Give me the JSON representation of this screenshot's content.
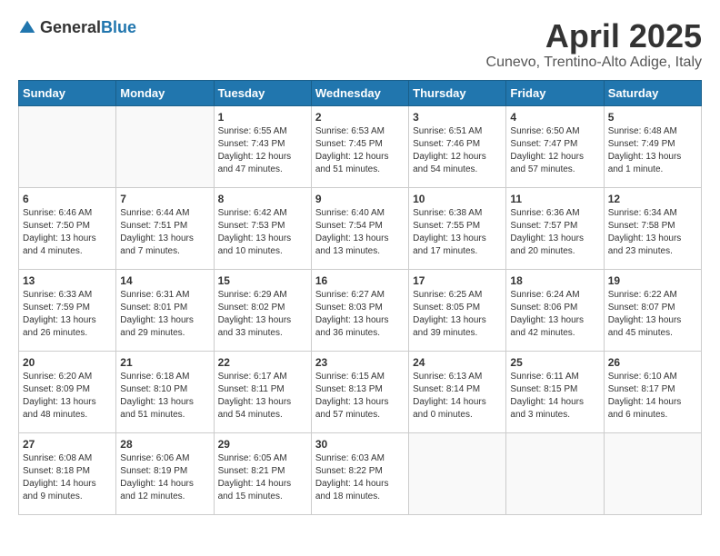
{
  "header": {
    "logo": {
      "general": "General",
      "blue": "Blue"
    },
    "title": "April 2025",
    "location": "Cunevo, Trentino-Alto Adige, Italy"
  },
  "calendar": {
    "weekdays": [
      "Sunday",
      "Monday",
      "Tuesday",
      "Wednesday",
      "Thursday",
      "Friday",
      "Saturday"
    ],
    "weeks": [
      [
        {
          "day": "",
          "info": ""
        },
        {
          "day": "",
          "info": ""
        },
        {
          "day": "1",
          "info": "Sunrise: 6:55 AM\nSunset: 7:43 PM\nDaylight: 12 hours\nand 47 minutes."
        },
        {
          "day": "2",
          "info": "Sunrise: 6:53 AM\nSunset: 7:45 PM\nDaylight: 12 hours\nand 51 minutes."
        },
        {
          "day": "3",
          "info": "Sunrise: 6:51 AM\nSunset: 7:46 PM\nDaylight: 12 hours\nand 54 minutes."
        },
        {
          "day": "4",
          "info": "Sunrise: 6:50 AM\nSunset: 7:47 PM\nDaylight: 12 hours\nand 57 minutes."
        },
        {
          "day": "5",
          "info": "Sunrise: 6:48 AM\nSunset: 7:49 PM\nDaylight: 13 hours\nand 1 minute."
        }
      ],
      [
        {
          "day": "6",
          "info": "Sunrise: 6:46 AM\nSunset: 7:50 PM\nDaylight: 13 hours\nand 4 minutes."
        },
        {
          "day": "7",
          "info": "Sunrise: 6:44 AM\nSunset: 7:51 PM\nDaylight: 13 hours\nand 7 minutes."
        },
        {
          "day": "8",
          "info": "Sunrise: 6:42 AM\nSunset: 7:53 PM\nDaylight: 13 hours\nand 10 minutes."
        },
        {
          "day": "9",
          "info": "Sunrise: 6:40 AM\nSunset: 7:54 PM\nDaylight: 13 hours\nand 13 minutes."
        },
        {
          "day": "10",
          "info": "Sunrise: 6:38 AM\nSunset: 7:55 PM\nDaylight: 13 hours\nand 17 minutes."
        },
        {
          "day": "11",
          "info": "Sunrise: 6:36 AM\nSunset: 7:57 PM\nDaylight: 13 hours\nand 20 minutes."
        },
        {
          "day": "12",
          "info": "Sunrise: 6:34 AM\nSunset: 7:58 PM\nDaylight: 13 hours\nand 23 minutes."
        }
      ],
      [
        {
          "day": "13",
          "info": "Sunrise: 6:33 AM\nSunset: 7:59 PM\nDaylight: 13 hours\nand 26 minutes."
        },
        {
          "day": "14",
          "info": "Sunrise: 6:31 AM\nSunset: 8:01 PM\nDaylight: 13 hours\nand 29 minutes."
        },
        {
          "day": "15",
          "info": "Sunrise: 6:29 AM\nSunset: 8:02 PM\nDaylight: 13 hours\nand 33 minutes."
        },
        {
          "day": "16",
          "info": "Sunrise: 6:27 AM\nSunset: 8:03 PM\nDaylight: 13 hours\nand 36 minutes."
        },
        {
          "day": "17",
          "info": "Sunrise: 6:25 AM\nSunset: 8:05 PM\nDaylight: 13 hours\nand 39 minutes."
        },
        {
          "day": "18",
          "info": "Sunrise: 6:24 AM\nSunset: 8:06 PM\nDaylight: 13 hours\nand 42 minutes."
        },
        {
          "day": "19",
          "info": "Sunrise: 6:22 AM\nSunset: 8:07 PM\nDaylight: 13 hours\nand 45 minutes."
        }
      ],
      [
        {
          "day": "20",
          "info": "Sunrise: 6:20 AM\nSunset: 8:09 PM\nDaylight: 13 hours\nand 48 minutes."
        },
        {
          "day": "21",
          "info": "Sunrise: 6:18 AM\nSunset: 8:10 PM\nDaylight: 13 hours\nand 51 minutes."
        },
        {
          "day": "22",
          "info": "Sunrise: 6:17 AM\nSunset: 8:11 PM\nDaylight: 13 hours\nand 54 minutes."
        },
        {
          "day": "23",
          "info": "Sunrise: 6:15 AM\nSunset: 8:13 PM\nDaylight: 13 hours\nand 57 minutes."
        },
        {
          "day": "24",
          "info": "Sunrise: 6:13 AM\nSunset: 8:14 PM\nDaylight: 14 hours\nand 0 minutes."
        },
        {
          "day": "25",
          "info": "Sunrise: 6:11 AM\nSunset: 8:15 PM\nDaylight: 14 hours\nand 3 minutes."
        },
        {
          "day": "26",
          "info": "Sunrise: 6:10 AM\nSunset: 8:17 PM\nDaylight: 14 hours\nand 6 minutes."
        }
      ],
      [
        {
          "day": "27",
          "info": "Sunrise: 6:08 AM\nSunset: 8:18 PM\nDaylight: 14 hours\nand 9 minutes."
        },
        {
          "day": "28",
          "info": "Sunrise: 6:06 AM\nSunset: 8:19 PM\nDaylight: 14 hours\nand 12 minutes."
        },
        {
          "day": "29",
          "info": "Sunrise: 6:05 AM\nSunset: 8:21 PM\nDaylight: 14 hours\nand 15 minutes."
        },
        {
          "day": "30",
          "info": "Sunrise: 6:03 AM\nSunset: 8:22 PM\nDaylight: 14 hours\nand 18 minutes."
        },
        {
          "day": "",
          "info": ""
        },
        {
          "day": "",
          "info": ""
        },
        {
          "day": "",
          "info": ""
        }
      ]
    ]
  }
}
